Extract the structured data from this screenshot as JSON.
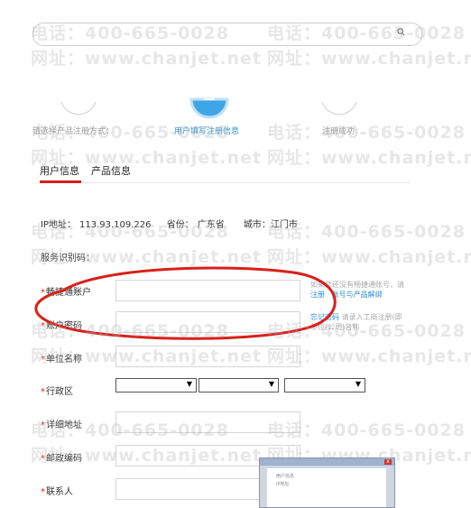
{
  "watermarks": {
    "phone": "电话：400-665-0028",
    "url": "网址：www.chanjet.net"
  },
  "steps": [
    {
      "number": "1",
      "label": "请选择产品注册方式："
    },
    {
      "number": "2",
      "label": "用户填写注册信息"
    },
    {
      "number": "3",
      "label": "注册成功"
    }
  ],
  "tabs": [
    {
      "label": "用户信息"
    },
    {
      "label": "产品信息"
    }
  ],
  "ip_info": {
    "ip_label": "IP地址：",
    "ip_value": "113.93.109.226",
    "province_label": "省份：",
    "province_value": "广东省",
    "city_label": "城市：",
    "city_value": "江门市"
  },
  "form": {
    "service_code_label": "服务识别码：",
    "required_mark": "*",
    "account_label": "畅捷通账户",
    "password_label": "账户密码",
    "unit_label": "单位名称",
    "region_label": "行政区",
    "address_label": "详细地址",
    "postcode_label": "邮政编码",
    "contact_label": "联系人",
    "account_hint_1": "如果您还没有畅捷通账号，请",
    "account_hint_link1": "注册",
    "account_hint_link2": "账号与产品解绑",
    "password_hint_link": "忘记密码",
    "password_hint_1": "请录入工商注册(即",
    "password_hint_2": "单位(公司)名称"
  },
  "thumbnail": {
    "close": "x",
    "line1": "用户信息",
    "line2": "IP地址"
  }
}
